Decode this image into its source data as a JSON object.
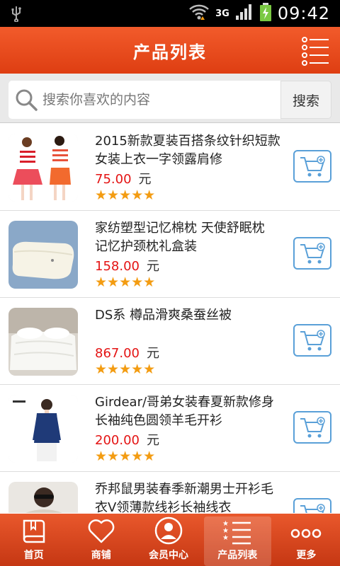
{
  "status_bar": {
    "time": "09:42",
    "network": "3G",
    "battery_color": "#7ac943"
  },
  "header": {
    "title": "产品列表",
    "menu_icon": "list-menu-icon"
  },
  "search": {
    "placeholder": "搜索你喜欢的内容",
    "button_label": "搜索"
  },
  "products": [
    {
      "name": "2015新款夏装百搭条纹针织短款女装上衣一字领露肩修",
      "price": "75.00",
      "unit": "元",
      "rating": 5
    },
    {
      "name": "家纺塑型记忆棉枕 天使舒眠枕 记忆护颈枕礼盒装",
      "price": "158.00",
      "unit": "元",
      "rating": 5
    },
    {
      "name": "DS系 樽品滑爽桑蚕丝被",
      "price": "867.00",
      "unit": "元",
      "rating": 5
    },
    {
      "name": "Girdear/哥弟女装春夏新款修身长袖纯色圆领羊毛开衫",
      "price": "200.00",
      "unit": "元",
      "rating": 5
    },
    {
      "name": "乔邦鼠男装春季新潮男士开衫毛衣V领薄款线衫长袖线衣",
      "price": "",
      "unit": "",
      "rating": 0
    }
  ],
  "tabbar": [
    {
      "label": "首页",
      "icon": "book-icon"
    },
    {
      "label": "商铺",
      "icon": "heart-icon"
    },
    {
      "label": "会员中心",
      "icon": "user-icon"
    },
    {
      "label": "产品列表",
      "icon": "star-list-icon",
      "active": true
    },
    {
      "label": "更多",
      "icon": "more-dots-icon"
    }
  ],
  "colors": {
    "accent": "#e64a1c",
    "price": "#e41414",
    "star": "#f39c12",
    "cart_border": "#5aa0d8"
  }
}
